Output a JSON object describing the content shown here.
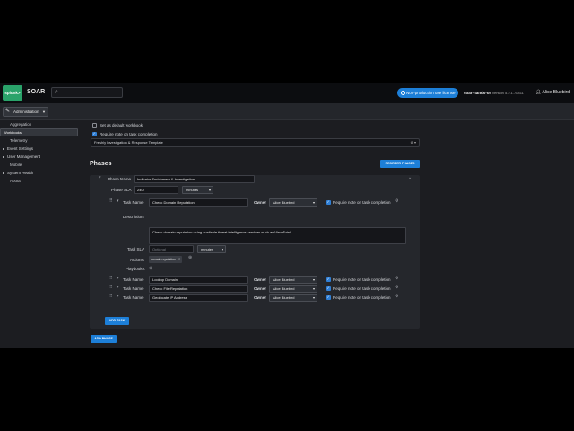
{
  "header": {
    "logo_text": "splunk>",
    "app_name": "SOAR",
    "license_label": "Non-production use license",
    "hostname": "soar-hands-on",
    "version": "version 5.2.1.78411",
    "user_name": "Alice Bluebird"
  },
  "admin_menu": {
    "label": "Administration"
  },
  "sidebar": {
    "items": [
      {
        "label": "Aggregation",
        "type": "item"
      },
      {
        "label": "Workbooks",
        "type": "item",
        "selected": true
      },
      {
        "label": "Telemetry",
        "type": "item"
      },
      {
        "label": "Event Settings",
        "type": "group"
      },
      {
        "label": "User Management",
        "type": "group"
      },
      {
        "label": "Mobile",
        "type": "item"
      },
      {
        "label": "System Health",
        "type": "group"
      },
      {
        "label": "About",
        "type": "item"
      }
    ]
  },
  "workbook": {
    "default_label": "Set as default workbook",
    "require_note_label": "Require note on task completion",
    "template_name": "Freshly Investigation & Response Template",
    "phases_heading": "Phases",
    "reorder_button": "REORDER PHASES",
    "add_phase_button": "ADD PHASE"
  },
  "phase": {
    "name_label": "Phase Name",
    "name_value": "Indicator Enrichment & Investigation",
    "sla_label": "Phase SLA",
    "sla_value": "240",
    "sla_unit": "minutes",
    "add_task_button": "ADD TASK"
  },
  "task_expanded": {
    "name_label": "Task Name",
    "name_value": "Check Domain Reputation",
    "owner_label": "Owner",
    "owner_value": "Alice Bluebird",
    "require_note_label": "Require note on task completion",
    "description_label": "Description:",
    "description_value": "Check domain reputation using available threat intelligence services such as VirusTotal",
    "task_sla_label": "Task SLA",
    "task_sla_placeholder": "Optional",
    "task_sla_unit": "minutes",
    "actions_label": "Actions:",
    "action_tag": "domain reputation",
    "playbooks_label": "Playbooks:"
  },
  "tasks": [
    {
      "name_label": "Task Name",
      "name_value": "Lookup Domain",
      "owner_label": "Owner",
      "owner_value": "Alice Bluebird",
      "require_note_label": "Require note on task completion"
    },
    {
      "name_label": "Task Name",
      "name_value": "Check File Reputation",
      "owner_label": "Owner",
      "owner_value": "Alice Bluebird",
      "require_note_label": "Require note on task completion"
    },
    {
      "name_label": "Task Name",
      "name_value": "Geolocate IP Address",
      "owner_label": "Owner",
      "owner_value": "Alice Bluebird",
      "require_note_label": "Require note on task completion"
    }
  ]
}
